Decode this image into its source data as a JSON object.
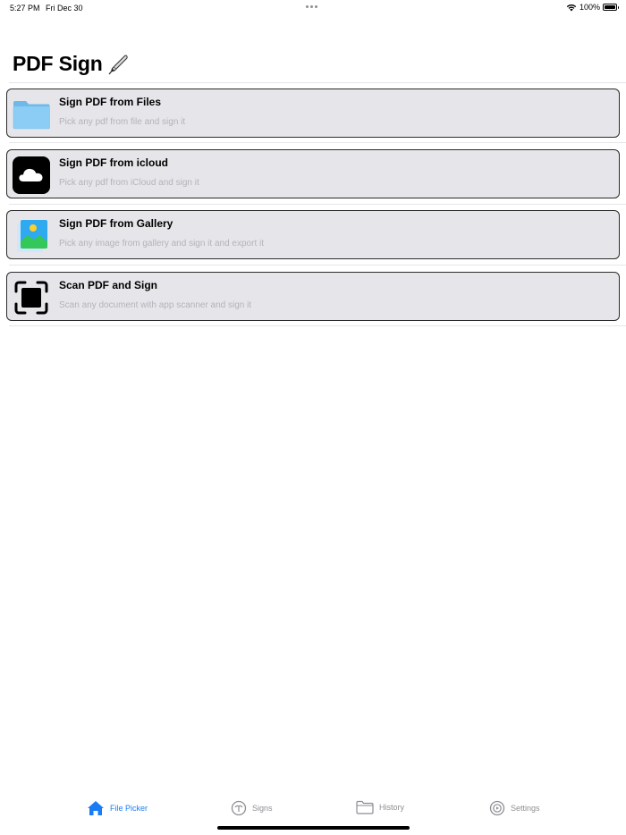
{
  "status_bar": {
    "time": "5:27 PM",
    "date": "Fri Dec 30",
    "battery": "100%"
  },
  "header": {
    "title": "PDF Sign",
    "title_icon": "pen-nib-icon"
  },
  "options": [
    {
      "title": "Sign PDF from Files",
      "subtitle": "Pick any pdf from file and sign it",
      "icon": "folder-icon"
    },
    {
      "title": "Sign PDF from icloud",
      "subtitle": "Pick any pdf from iCloud and sign it",
      "icon": "cloud-icon"
    },
    {
      "title": "Sign PDF from Gallery",
      "subtitle": "Pick any image from gallery and sign it and export it",
      "icon": "gallery-icon"
    },
    {
      "title": "Scan PDF and Sign",
      "subtitle": "Scan any document with app scanner and sign it",
      "icon": "scanner-icon"
    }
  ],
  "tab_bar": {
    "tabs": [
      {
        "label": "File Picker",
        "icon": "house-icon",
        "active": true
      },
      {
        "label": "Signs",
        "icon": "signature-icon",
        "active": false
      },
      {
        "label": "History",
        "icon": "folder-outline-icon",
        "active": false
      },
      {
        "label": "Settings",
        "icon": "gear-icon",
        "active": false
      }
    ]
  },
  "colors": {
    "accent": "#1a7cf5",
    "row_background": "#e6e6ea",
    "subtitle_gray": "#b3b3b8",
    "inactive_tab": "#8e8e93"
  }
}
